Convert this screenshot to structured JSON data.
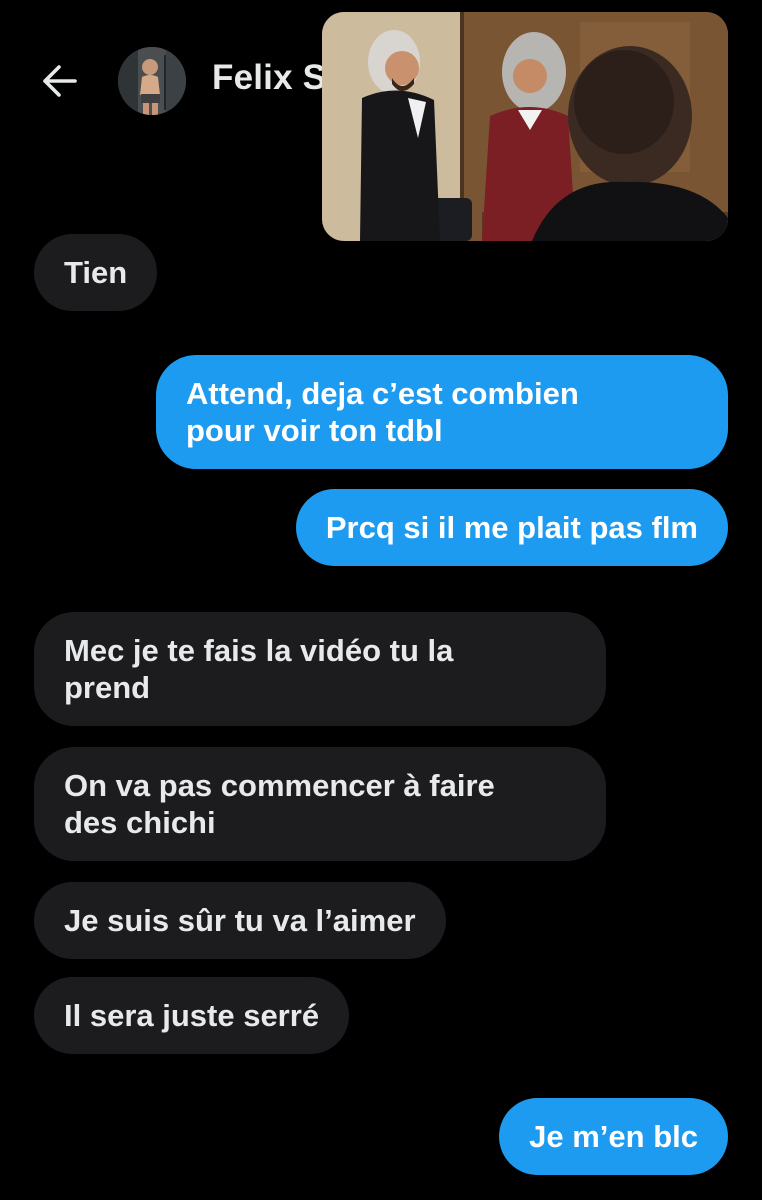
{
  "header": {
    "back_icon": "arrow-left-icon",
    "contact_name": "Felix S",
    "avatar_desc": "profile photo"
  },
  "video": {
    "type": "picture-in-picture video"
  },
  "messages": [
    {
      "direction": "in",
      "lines": [
        "Tien"
      ]
    },
    {
      "direction": "out",
      "lines": [
        "Attend, deja c’est combien",
        "pour voir ton tdbl"
      ]
    },
    {
      "direction": "out",
      "lines": [
        "Prcq si il me plait pas flm"
      ]
    },
    {
      "direction": "in",
      "lines": [
        "Mec je te fais la vidéo tu la",
        "prend"
      ]
    },
    {
      "direction": "in",
      "lines": [
        "On va pas commencer à faire",
        "des chichi"
      ]
    },
    {
      "direction": "in",
      "lines": [
        "Je suis sûr tu va l’aimer"
      ]
    },
    {
      "direction": "in",
      "lines": [
        "Il sera juste serré"
      ]
    },
    {
      "direction": "out",
      "lines": [
        "Je m’en blc"
      ]
    }
  ],
  "colors": {
    "background": "#000000",
    "incoming_bubble": "#1c1c1e",
    "outgoing_bubble": "#1d9bf0",
    "text": "#e7e9ea"
  }
}
